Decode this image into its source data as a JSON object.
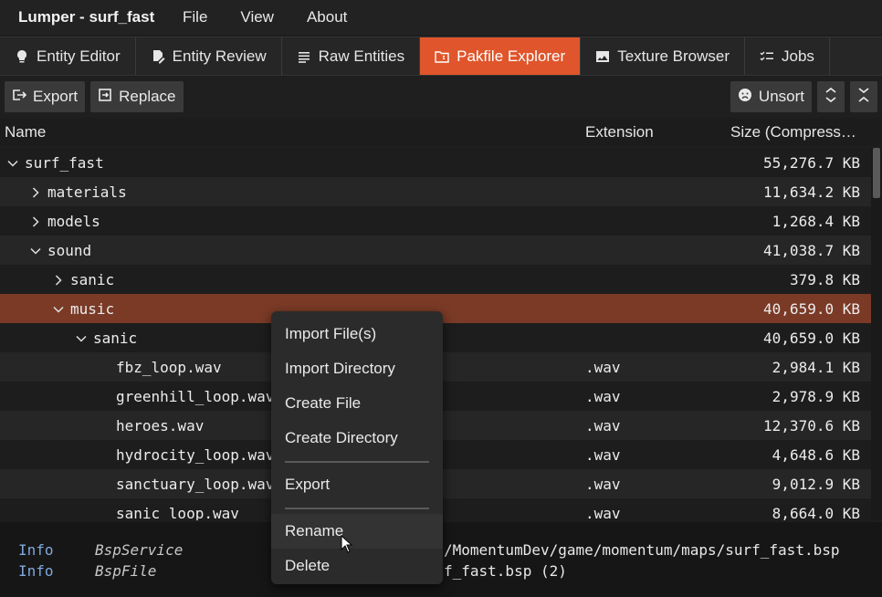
{
  "app": {
    "title": "Lumper - surf_fast"
  },
  "menu": [
    "File",
    "View",
    "About"
  ],
  "tabs": [
    {
      "label": "Entity Editor",
      "icon": "lightbulb-icon"
    },
    {
      "label": "Entity Review",
      "icon": "edit-document-icon"
    },
    {
      "label": "Raw Entities",
      "icon": "list-icon"
    },
    {
      "label": "Pakfile Explorer",
      "icon": "folder-zip-icon",
      "active": true
    },
    {
      "label": "Texture Browser",
      "icon": "image-icon"
    },
    {
      "label": "Jobs",
      "icon": "checklist-icon"
    }
  ],
  "toolbar": {
    "export_label": "Export",
    "replace_label": "Replace",
    "unsort_label": "Unsort"
  },
  "table": {
    "headers": {
      "name": "Name",
      "extension": "Extension",
      "size": "Size (Compressed)"
    },
    "rows": [
      {
        "name": "surf_fast",
        "ext": "",
        "size": "55,276.7 KB",
        "depth": 0,
        "chevron": "down"
      },
      {
        "name": "materials",
        "ext": "",
        "size": "11,634.2 KB",
        "depth": 1,
        "chevron": "right"
      },
      {
        "name": "models",
        "ext": "",
        "size": "1,268.4 KB",
        "depth": 1,
        "chevron": "right"
      },
      {
        "name": "sound",
        "ext": "",
        "size": "41,038.7 KB",
        "depth": 1,
        "chevron": "down"
      },
      {
        "name": "sanic",
        "ext": "",
        "size": "379.8 KB",
        "depth": 2,
        "chevron": "right"
      },
      {
        "name": "music",
        "ext": "",
        "size": "40,659.0 KB",
        "depth": 2,
        "chevron": "down",
        "selected": true
      },
      {
        "name": "sanic",
        "ext": "",
        "size": "40,659.0 KB",
        "depth": 3,
        "chevron": "down"
      },
      {
        "name": "fbz_loop.wav",
        "ext": ".wav",
        "size": "2,984.1 KB",
        "depth": 4,
        "chevron": ""
      },
      {
        "name": "greenhill_loop.wav",
        "ext": ".wav",
        "size": "2,978.9 KB",
        "depth": 4,
        "chevron": ""
      },
      {
        "name": "heroes.wav",
        "ext": ".wav",
        "size": "12,370.6 KB",
        "depth": 4,
        "chevron": ""
      },
      {
        "name": "hydrocity_loop.wav",
        "ext": ".wav",
        "size": "4,648.6 KB",
        "depth": 4,
        "chevron": ""
      },
      {
        "name": "sanctuary_loop.wav",
        "ext": ".wav",
        "size": "9,012.9 KB",
        "depth": 4,
        "chevron": ""
      },
      {
        "name": "sanic_loop.wav",
        "ext": ".wav",
        "size": "8,664.0 KB",
        "depth": 4,
        "chevron": ""
      }
    ]
  },
  "context_menu": {
    "items": [
      "Import File(s)",
      "Import Directory",
      "Create File",
      "Create Directory",
      "Export",
      "Rename",
      "Delete"
    ]
  },
  "log": [
    {
      "level": "Info",
      "source": "BspService",
      "message": "/MomentumDev/game/momentum/maps/surf_fast.bsp"
    },
    {
      "level": "Info",
      "source": "BspFile",
      "message": "f_fast.bsp (2)"
    }
  ],
  "colors": {
    "accent": "#e0552b",
    "selected_row": "#7a3a26"
  }
}
